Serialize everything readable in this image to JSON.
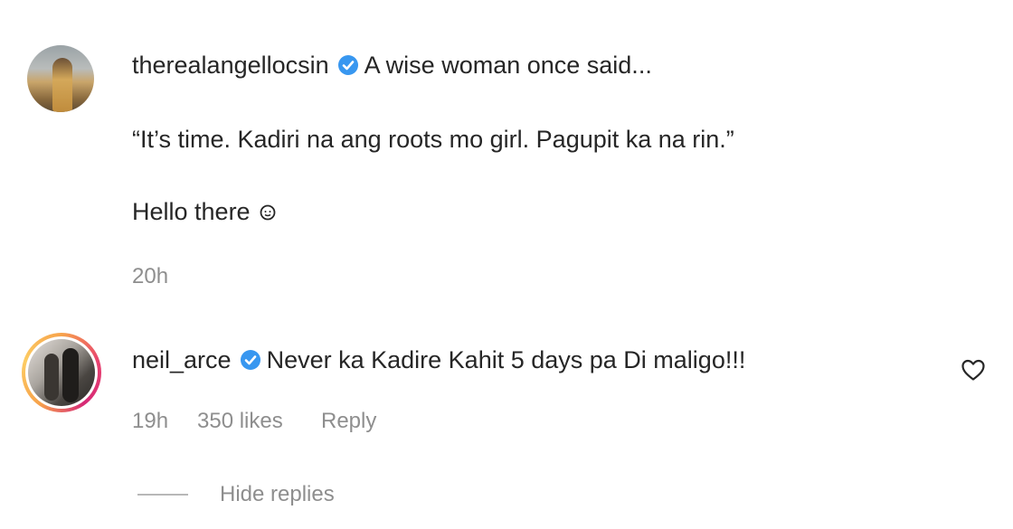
{
  "comments": [
    {
      "username": "therealangellocsin",
      "verified": true,
      "first_line": "A wise woman once said...",
      "quote": "“It’s time. Kadiri na ang roots mo girl. Pagupit ka na rin.”",
      "closing": "Hello there",
      "timestamp": "20h"
    },
    {
      "username": "neil_arce",
      "verified": true,
      "text": "Never ka Kadire Kahit 5 days pa Di maligo!!!",
      "timestamp": "19h",
      "likes": "350 likes",
      "reply_label": "Reply"
    }
  ],
  "replies": {
    "toggle_label": "Hide replies"
  },
  "colors": {
    "verified_blue": "#3897f0",
    "muted_text": "#8e8e8e",
    "primary_text": "#262626"
  },
  "icons": {
    "verified": "verified-badge-icon",
    "like": "heart-outline-icon",
    "emoji": "face-emoji-icon"
  }
}
